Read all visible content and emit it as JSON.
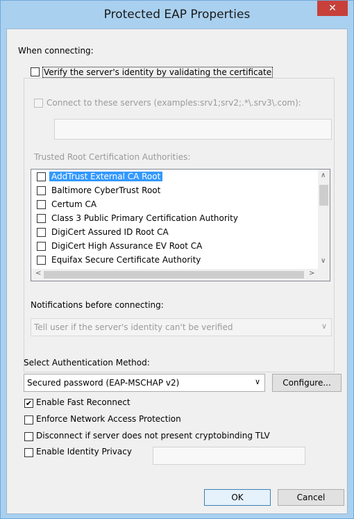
{
  "window": {
    "title": "Protected EAP Properties",
    "close_glyph": "✕"
  },
  "when_connecting_label": "When connecting:",
  "verify": {
    "label": "Verify the server's identity by validating the certificate",
    "checked": false
  },
  "connect_servers": {
    "label": "Connect to these servers (examples:srv1;srv2;.*\\.srv3\\.com):",
    "value": ""
  },
  "trusted_root": {
    "label": "Trusted Root Certification Authorities:",
    "items": [
      {
        "label": "AddTrust External CA Root",
        "selected": true
      },
      {
        "label": "Baltimore CyberTrust Root"
      },
      {
        "label": "Certum CA"
      },
      {
        "label": "Class 3 Public Primary Certification Authority"
      },
      {
        "label": "DigiCert Assured ID Root CA"
      },
      {
        "label": "DigiCert High Assurance EV Root CA"
      },
      {
        "label": "Equifax Secure Certificate Authority"
      }
    ]
  },
  "notifications": {
    "label": "Notifications before connecting:",
    "value": "Tell user if the server's identity can't be verified"
  },
  "auth": {
    "label": "Select Authentication Method:",
    "value": "Secured password (EAP-MSCHAP v2)",
    "configure": "Configure..."
  },
  "options": [
    {
      "label": "Enable Fast Reconnect",
      "checked": true
    },
    {
      "label": "Enforce Network Access Protection",
      "checked": false
    },
    {
      "label": "Disconnect if server does not present cryptobinding TLV",
      "checked": false
    },
    {
      "label": "Enable Identity Privacy",
      "checked": false
    }
  ],
  "identity_value": "",
  "buttons": {
    "ok": "OK",
    "cancel": "Cancel"
  },
  "glyphs": {
    "check": "✔",
    "up": "∧",
    "down": "∨",
    "left": "<",
    "right": ">"
  }
}
